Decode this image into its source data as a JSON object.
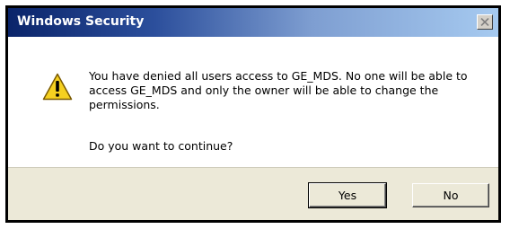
{
  "dialog": {
    "title": "Windows Security",
    "close_icon": "close-icon",
    "warning_icon": "warning-triangle-icon",
    "message": "You have denied all users access to GE_MDS. No one will be able to access GE_MDS and only the owner will be able to change the permissions.",
    "question": "Do you want to continue?",
    "buttons": {
      "yes": "Yes",
      "no": "No"
    },
    "colors": {
      "titlebar_start": "#0a246a",
      "titlebar_end": "#a6caf0",
      "warning_fill": "#f5d020"
    }
  }
}
